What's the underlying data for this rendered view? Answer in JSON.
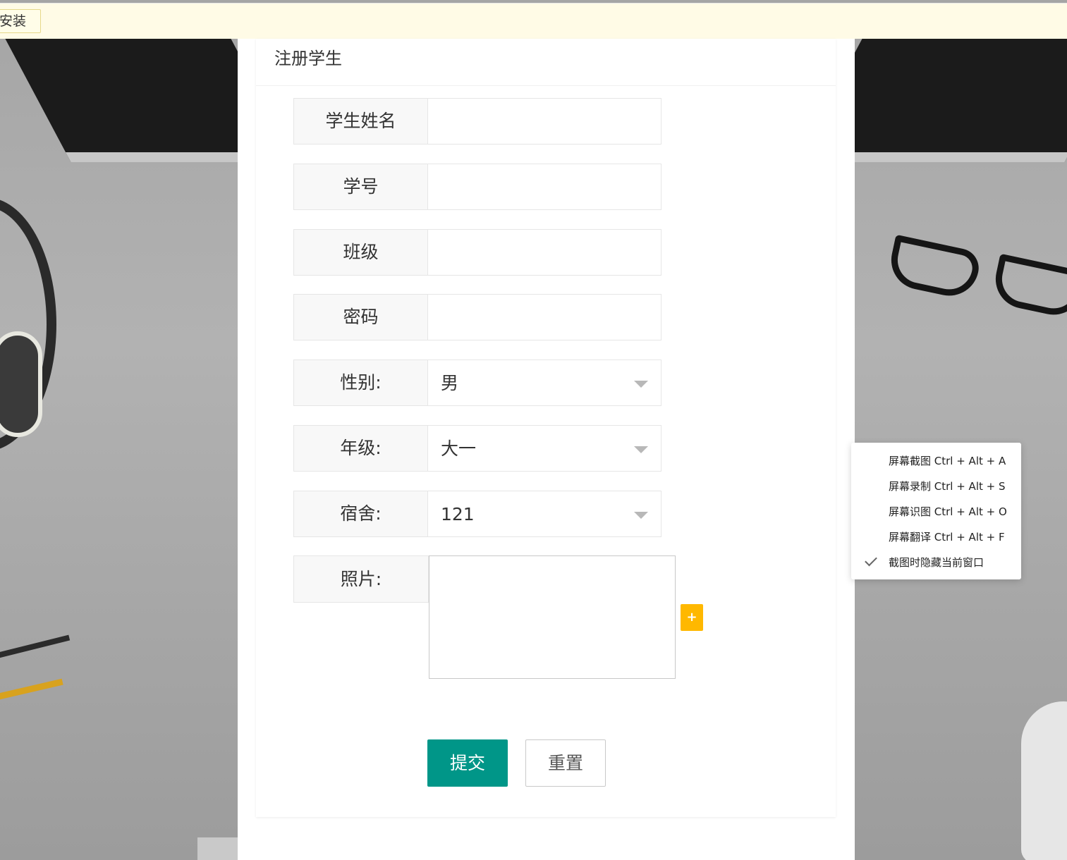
{
  "notice": {
    "install_label": "安装"
  },
  "card": {
    "title": "注册学生"
  },
  "fields": {
    "name": {
      "label": "学生姓名",
      "value": ""
    },
    "student_id": {
      "label": "学号",
      "value": ""
    },
    "class": {
      "label": "班级",
      "value": ""
    },
    "password": {
      "label": "密码",
      "value": ""
    },
    "gender": {
      "label": "性别:",
      "selected": "男"
    },
    "grade": {
      "label": "年级:",
      "selected": "大一"
    },
    "dorm": {
      "label": "宿舍:",
      "selected": "121"
    },
    "photo": {
      "label": "照片:",
      "add_label": "+"
    }
  },
  "actions": {
    "submit": "提交",
    "reset": "重置"
  },
  "context_menu": {
    "items": [
      {
        "label": "屏幕截图 Ctrl + Alt + A",
        "checked": false
      },
      {
        "label": "屏幕录制 Ctrl + Alt + S",
        "checked": false
      },
      {
        "label": "屏幕识图 Ctrl + Alt + O",
        "checked": false
      },
      {
        "label": "屏幕翻译 Ctrl + Alt + F",
        "checked": false
      },
      {
        "label": "截图时隐藏当前窗口",
        "checked": true
      }
    ]
  },
  "colors": {
    "submit_bg": "#009688",
    "add_bg": "#ffb800",
    "notice_bg": "#fffbe6"
  }
}
